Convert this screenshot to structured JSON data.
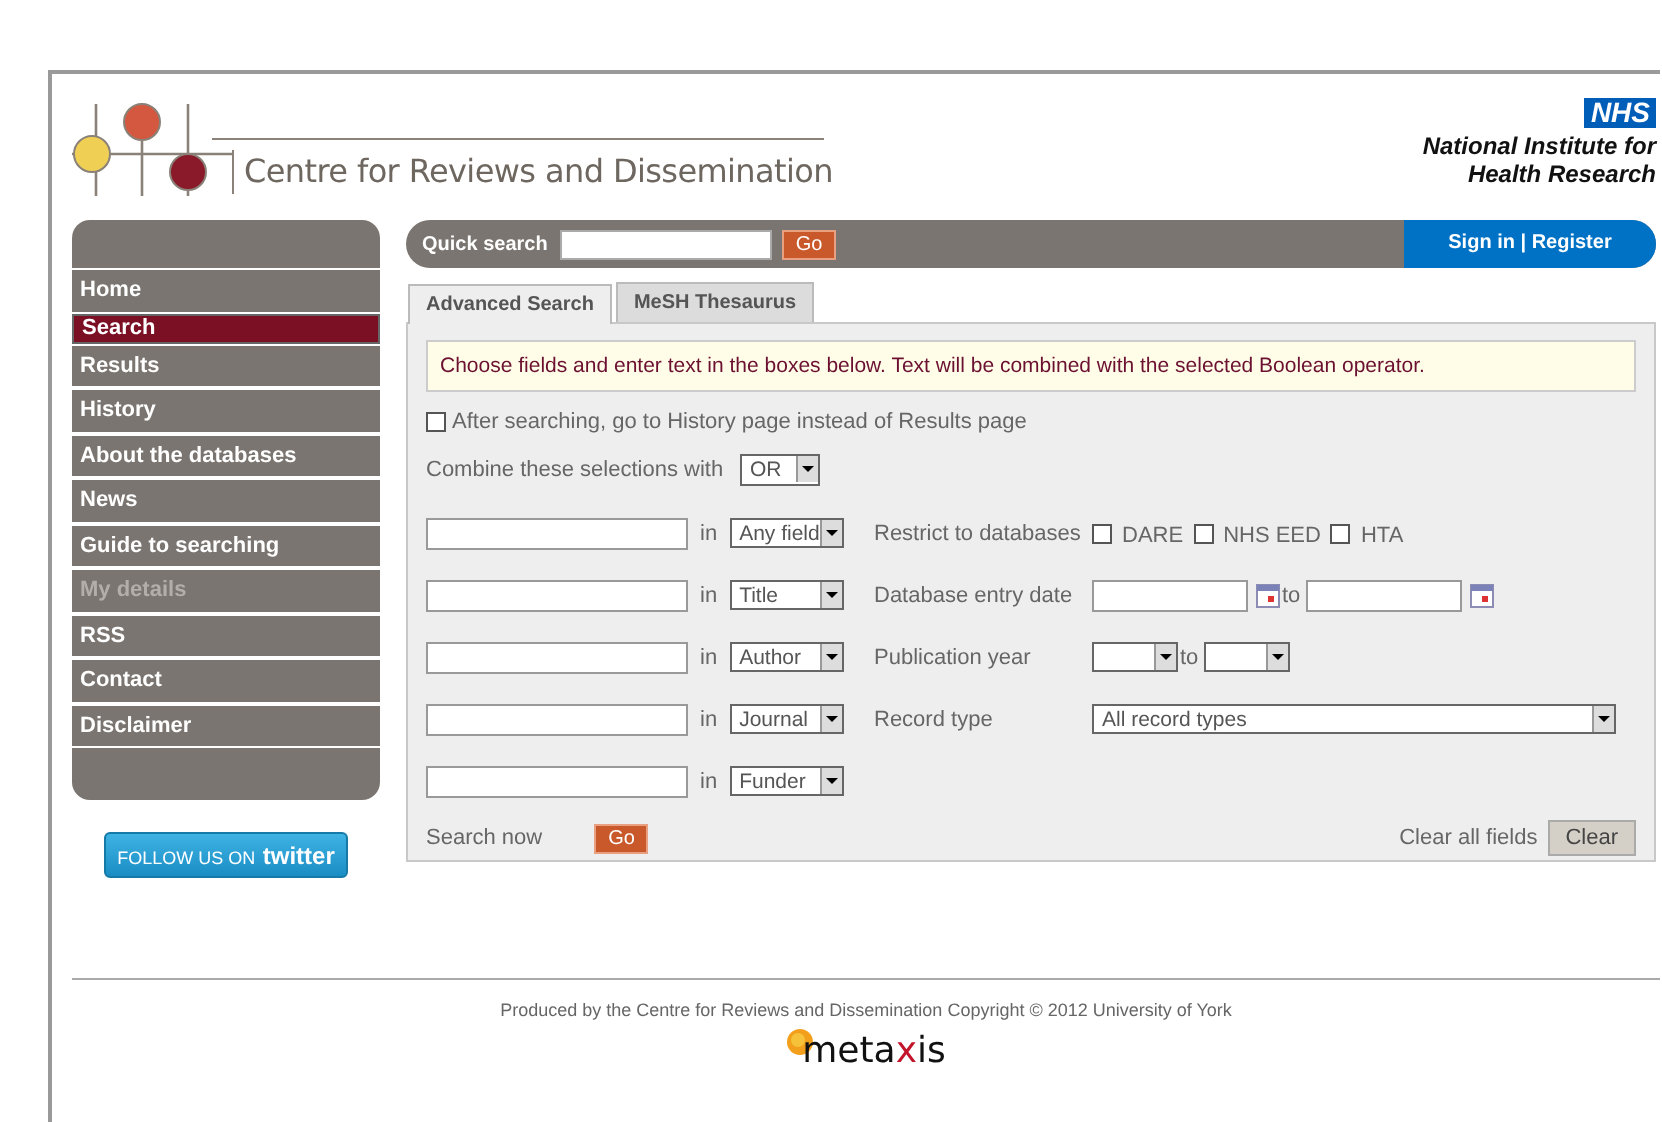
{
  "header": {
    "site_title": "Centre for Reviews and Dissemination",
    "nhs_badge": "NHS",
    "institute": [
      "National Institute for",
      "Health Research"
    ]
  },
  "quick_search": {
    "label": "Quick search",
    "button": "Go",
    "account_link": "Sign in | Register"
  },
  "sidebar": {
    "items": [
      {
        "label": "Home",
        "selected": false,
        "disabled": false
      },
      {
        "label": "Search",
        "selected": true,
        "disabled": false
      },
      {
        "label": "Results",
        "selected": false,
        "disabled": false
      },
      {
        "label": "History",
        "selected": false,
        "disabled": false
      },
      {
        "label": "About the databases",
        "selected": false,
        "disabled": false
      },
      {
        "label": "News",
        "selected": false,
        "disabled": false
      },
      {
        "label": "Guide to searching",
        "selected": false,
        "disabled": false
      },
      {
        "label": "My details",
        "selected": false,
        "disabled": true
      },
      {
        "label": "RSS",
        "selected": false,
        "disabled": false
      },
      {
        "label": "Contact",
        "selected": false,
        "disabled": false
      },
      {
        "label": "Disclaimer",
        "selected": false,
        "disabled": false
      }
    ],
    "twitter_button": [
      "FOLLOW US ON",
      "twitter"
    ]
  },
  "tabs": [
    {
      "label": "Advanced Search",
      "selected": true
    },
    {
      "label": "MeSH Thesaurus",
      "selected": false
    }
  ],
  "notice": "Choose fields and enter text in the boxes below. Text will be combined with the selected Boolean operator.",
  "history_option": {
    "label": "After searching, go to History page instead of Results page",
    "checked": false
  },
  "combine": {
    "label": "Combine these selections with",
    "value": "OR"
  },
  "search_rows": [
    {
      "in": "in",
      "field": "Any field"
    },
    {
      "in": "in",
      "field": "Title"
    },
    {
      "in": "in",
      "field": "Author"
    },
    {
      "in": "in",
      "field": "Journal"
    },
    {
      "in": "in",
      "field": "Funder"
    }
  ],
  "filters": [
    {
      "kind": "checkboxes",
      "label": "Restrict to databases",
      "options": [
        {
          "label": "DARE",
          "checked": false
        },
        {
          "label": "NHS EED",
          "checked": false
        },
        {
          "label": "HTA",
          "checked": false
        }
      ]
    },
    {
      "kind": "daterange",
      "label": "Database entry date",
      "to": "to"
    },
    {
      "kind": "yearrange",
      "label": "Publication year",
      "to": "to"
    },
    {
      "kind": "select",
      "label": "Record type",
      "value": "All record types"
    }
  ],
  "actions": {
    "search_label": "Search now",
    "search_button": "Go",
    "clear_label": "Clear all fields",
    "clear_button": "Clear"
  },
  "footer": {
    "credit": "Produced by the Centre for Reviews and Dissemination Copyright © 2012 University of York",
    "logo": [
      {
        "text": "meta",
        "accent": false
      },
      {
        "text": "x",
        "accent": true
      },
      {
        "text": "is",
        "accent": false
      }
    ]
  }
}
